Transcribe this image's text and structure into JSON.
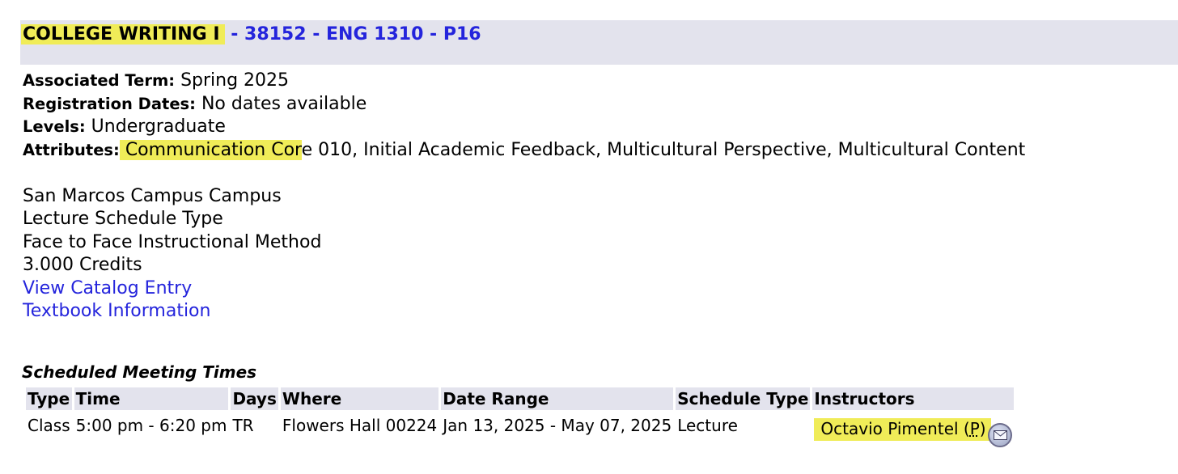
{
  "header": {
    "course_name": "COLLEGE WRITING I",
    "course_code": " - 38152 - ENG 1310 - P16"
  },
  "details": {
    "term_label": "Associated Term:",
    "term_value": " Spring 2025",
    "reg_label": "Registration Dates:",
    "reg_value": " No dates available",
    "levels_label": "Levels:",
    "levels_value": " Undergraduate",
    "attributes_label": "Attributes:",
    "attributes_hl": " Communication Cor",
    "attributes_rest": "e 010, Initial Academic Feedback, Multicultural Perspective, Multicultural Content",
    "campus": "San Marcos Campus Campus",
    "schedule_type": "Lecture Schedule Type",
    "instructional_method": "Face to Face Instructional Method",
    "credits": "3.000 Credits",
    "catalog_link": "View Catalog Entry",
    "textbook_link": "Textbook Information"
  },
  "meetings": {
    "title": "Scheduled Meeting Times",
    "columns": [
      "Type",
      "Time",
      "Days",
      "Where",
      "Date Range",
      "Schedule Type",
      "Instructors"
    ],
    "rows": [
      {
        "type": "Class",
        "time": "5:00 pm - 6:20 pm",
        "days": "TR",
        "where": "Flowers Hall 00224",
        "date_range": "Jan 13, 2025 - May 07, 2025",
        "schedule_type": "Lecture",
        "instructor": "Octavio Pimentel (",
        "instructor_p": "P",
        "instructor_close": ")"
      }
    ]
  },
  "icons": {
    "email": "email-icon"
  },
  "colors": {
    "highlight": "#f0ec58",
    "link": "#2424dc",
    "header_bg": "#e3e3ed"
  }
}
